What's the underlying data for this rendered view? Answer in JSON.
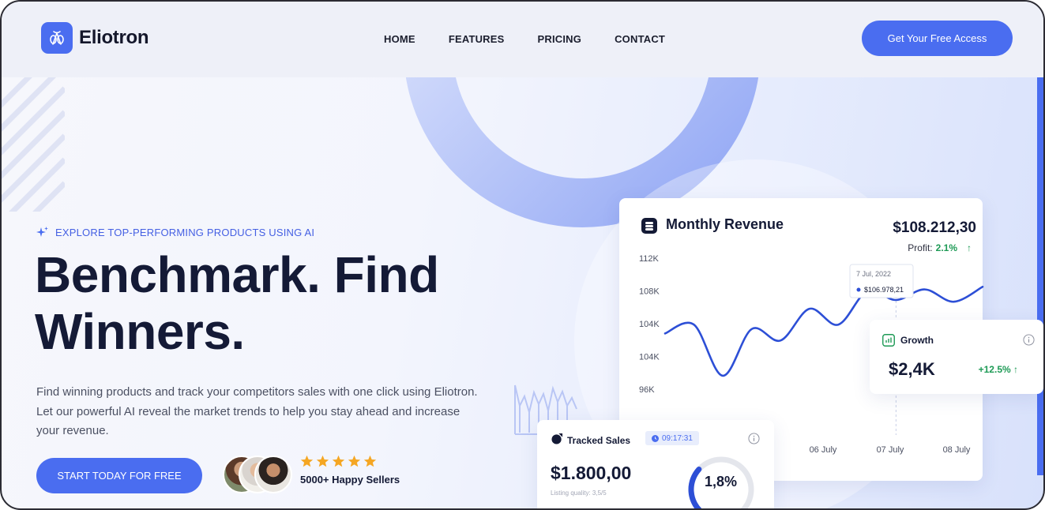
{
  "brand": {
    "name": "Eliotron",
    "accent": "#4a6df0",
    "text_dark": "#141a36",
    "success": "#1d9a55"
  },
  "nav": {
    "items": [
      "HOME",
      "FEATURES",
      "PRICING",
      "CONTACT"
    ],
    "cta": "Get Your Free Access"
  },
  "hero": {
    "eyebrow": "EXPLORE TOP-PERFORMING PRODUCTS USING AI",
    "headline_line1": "Benchmark. Find",
    "headline_line2": "Winners.",
    "description": "Find winning products and track your competitors sales with one click using Eliotron. Let our powerful AI reveal the market trends to help you stay ahead and increase your revenue.",
    "cta": "START TODAY FOR FREE",
    "rating": 5,
    "social_proof": "5000+ Happy Sellers"
  },
  "revenue_card": {
    "title": "Monthly Revenue",
    "icon": "wallet-icon",
    "total": "$108.212,30",
    "profit_label": "Profit:",
    "profit_value": "2.1%",
    "profit_arrow": "↑",
    "tooltip": {
      "date": "7 Jul, 2022",
      "value": "$106.978,21"
    }
  },
  "chart_data": {
    "type": "line",
    "title": "Monthly Revenue",
    "y_tick_labels": [
      "112K",
      "108K",
      "104K",
      "104K",
      "96K"
    ],
    "x_tick_labels": [
      "06 July",
      "07 July",
      "08 July"
    ],
    "series": [
      {
        "color": "#2d4fd6",
        "values": [
          103.6,
          104.6,
          98.8,
          104.1,
          102.8,
          106.4,
          104.6,
          108.4,
          107.4,
          108.6,
          107.2,
          108.9
        ]
      }
    ],
    "highlight": {
      "date": "7 Jul, 2022",
      "value": 106978.21
    },
    "grid": false
  },
  "growth_card": {
    "title": "Growth",
    "icon": "bar-chart-icon",
    "value": "$2,4K",
    "change": "+12.5% ↑"
  },
  "tracked_sales_card": {
    "title": "Tracked Sales",
    "icon": "pie-chart-icon",
    "timer": "09:17:31",
    "value": "$1.800,00",
    "quality": "Listing quality: 3,5/5",
    "gauge_label": "1,8%",
    "gauge_fraction": 0.33
  }
}
